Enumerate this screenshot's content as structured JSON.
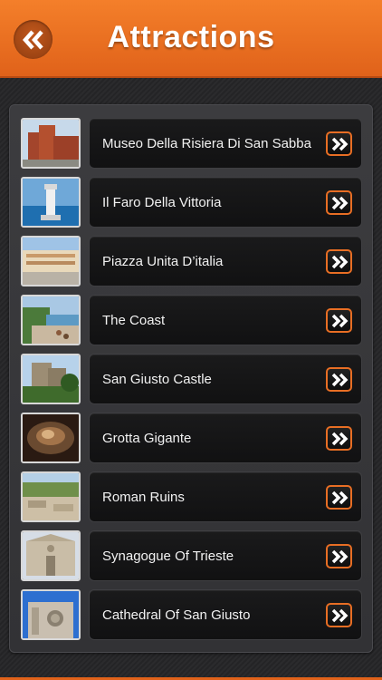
{
  "header": {
    "title": "Attractions",
    "back_icon": "double-chevron-left-icon",
    "accent": "#e86e24"
  },
  "attractions": [
    {
      "label": "Museo Della Risiera Di San Sabba"
    },
    {
      "label": "Il Faro Della Vittoria"
    },
    {
      "label": "Piazza Unita D’italia"
    },
    {
      "label": "The Coast"
    },
    {
      "label": "San Giusto Castle"
    },
    {
      "label": "Grotta Gigante"
    },
    {
      "label": "Roman Ruins"
    },
    {
      "label": "Synagogue Of Trieste"
    },
    {
      "label": "Cathedral Of San Giusto"
    }
  ],
  "item_icon": "double-chevron-right-icon"
}
